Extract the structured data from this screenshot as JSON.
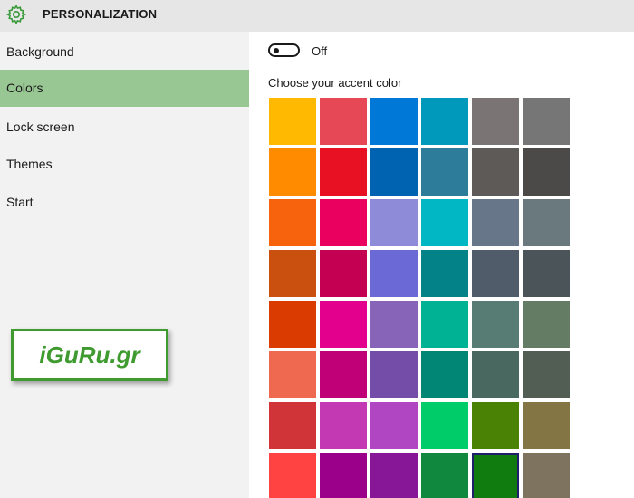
{
  "app": {
    "title": "PERSONALIZATION",
    "icon": "gear-icon",
    "accent": "#3a9a3a"
  },
  "sidebar": {
    "items": [
      {
        "label": "Background",
        "selected": false
      },
      {
        "label": "Colors",
        "selected": true
      },
      {
        "label": "Lock screen",
        "selected": false
      },
      {
        "label": "Themes",
        "selected": false
      },
      {
        "label": "Start",
        "selected": false
      }
    ],
    "selected_color": "#99c794"
  },
  "watermark": {
    "text": "iGuRu.gr",
    "color": "#3f9b2f"
  },
  "main": {
    "clipped_text": "",
    "toggle": {
      "state": "Off",
      "on": false
    },
    "accent_label": "Choose your accent color",
    "selected_swatch": 46,
    "swatches": [
      "#ffb900",
      "#e74856",
      "#0078d7",
      "#0099bc",
      "#7a7574",
      "#767676",
      "#ff8c00",
      "#e81123",
      "#0063b1",
      "#2d7d9a",
      "#5d5a58",
      "#4c4a48",
      "#f7630c",
      "#ea005e",
      "#8e8cd8",
      "#00b7c3",
      "#68768a",
      "#69797e",
      "#ca5010",
      "#c30052",
      "#6b69d6",
      "#038387",
      "#515c6b",
      "#4a5459",
      "#da3b01",
      "#e3008c",
      "#8764b8",
      "#00b294",
      "#567c73",
      "#647c64",
      "#ef6950",
      "#bf0077",
      "#744da9",
      "#018574",
      "#486860",
      "#525e54",
      "#d13438",
      "#c239b3",
      "#b146c2",
      "#00cc6a",
      "#498205",
      "#847545",
      "#ff4343",
      "#9a0089",
      "#881798",
      "#10893e",
      "#107c10",
      "#7e735f"
    ]
  }
}
